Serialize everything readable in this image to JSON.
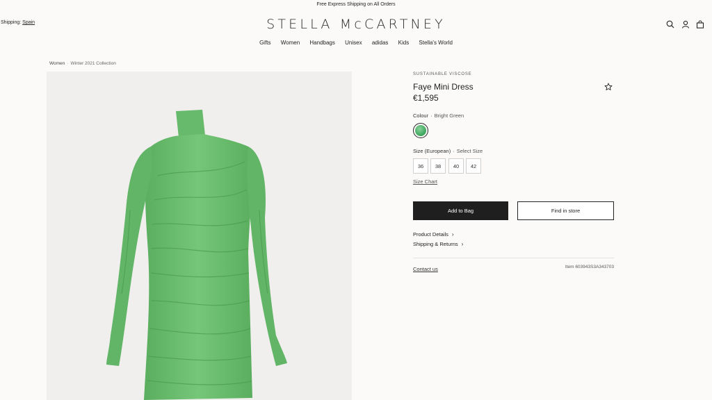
{
  "top_banner": "Free Express Shipping on All Orders",
  "shipping": {
    "label": "Shipping:",
    "country": "Spain"
  },
  "brand": "STELLA McCARTNEY",
  "nav": [
    "Gifts",
    "Women",
    "Handbags",
    "Unisex",
    "adidas",
    "Kids",
    "Stella's World"
  ],
  "header_icons": [
    "search-icon",
    "account-icon",
    "bag-icon"
  ],
  "breadcrumb": {
    "items": [
      "Women",
      "Winter 2021 Collection"
    ],
    "separator": "·"
  },
  "product": {
    "eyebrow": "SUSTAINABLE VISCOSE",
    "title": "Faye Mini Dress",
    "price": "€1,595",
    "colour_label": "Colour",
    "colour_value": "Bright Green",
    "colour_swatch": "#4caf68",
    "size_label": "Size (European)",
    "size_prompt": "Select Size",
    "sizes": [
      "36",
      "38",
      "40",
      "42"
    ],
    "size_chart": "Size Chart",
    "add_to_bag": "Add to Bag",
    "find_in_store": "Find in store",
    "links": [
      "Product Details",
      "Shipping & Returns"
    ],
    "contact": "Contact us",
    "item_number": "Item 603943S3A343703"
  },
  "colors": {
    "accent": "#1f1f1f",
    "dress": "#6cbf6f",
    "background": "#fbfaf8",
    "image_bg": "#f0efee"
  }
}
